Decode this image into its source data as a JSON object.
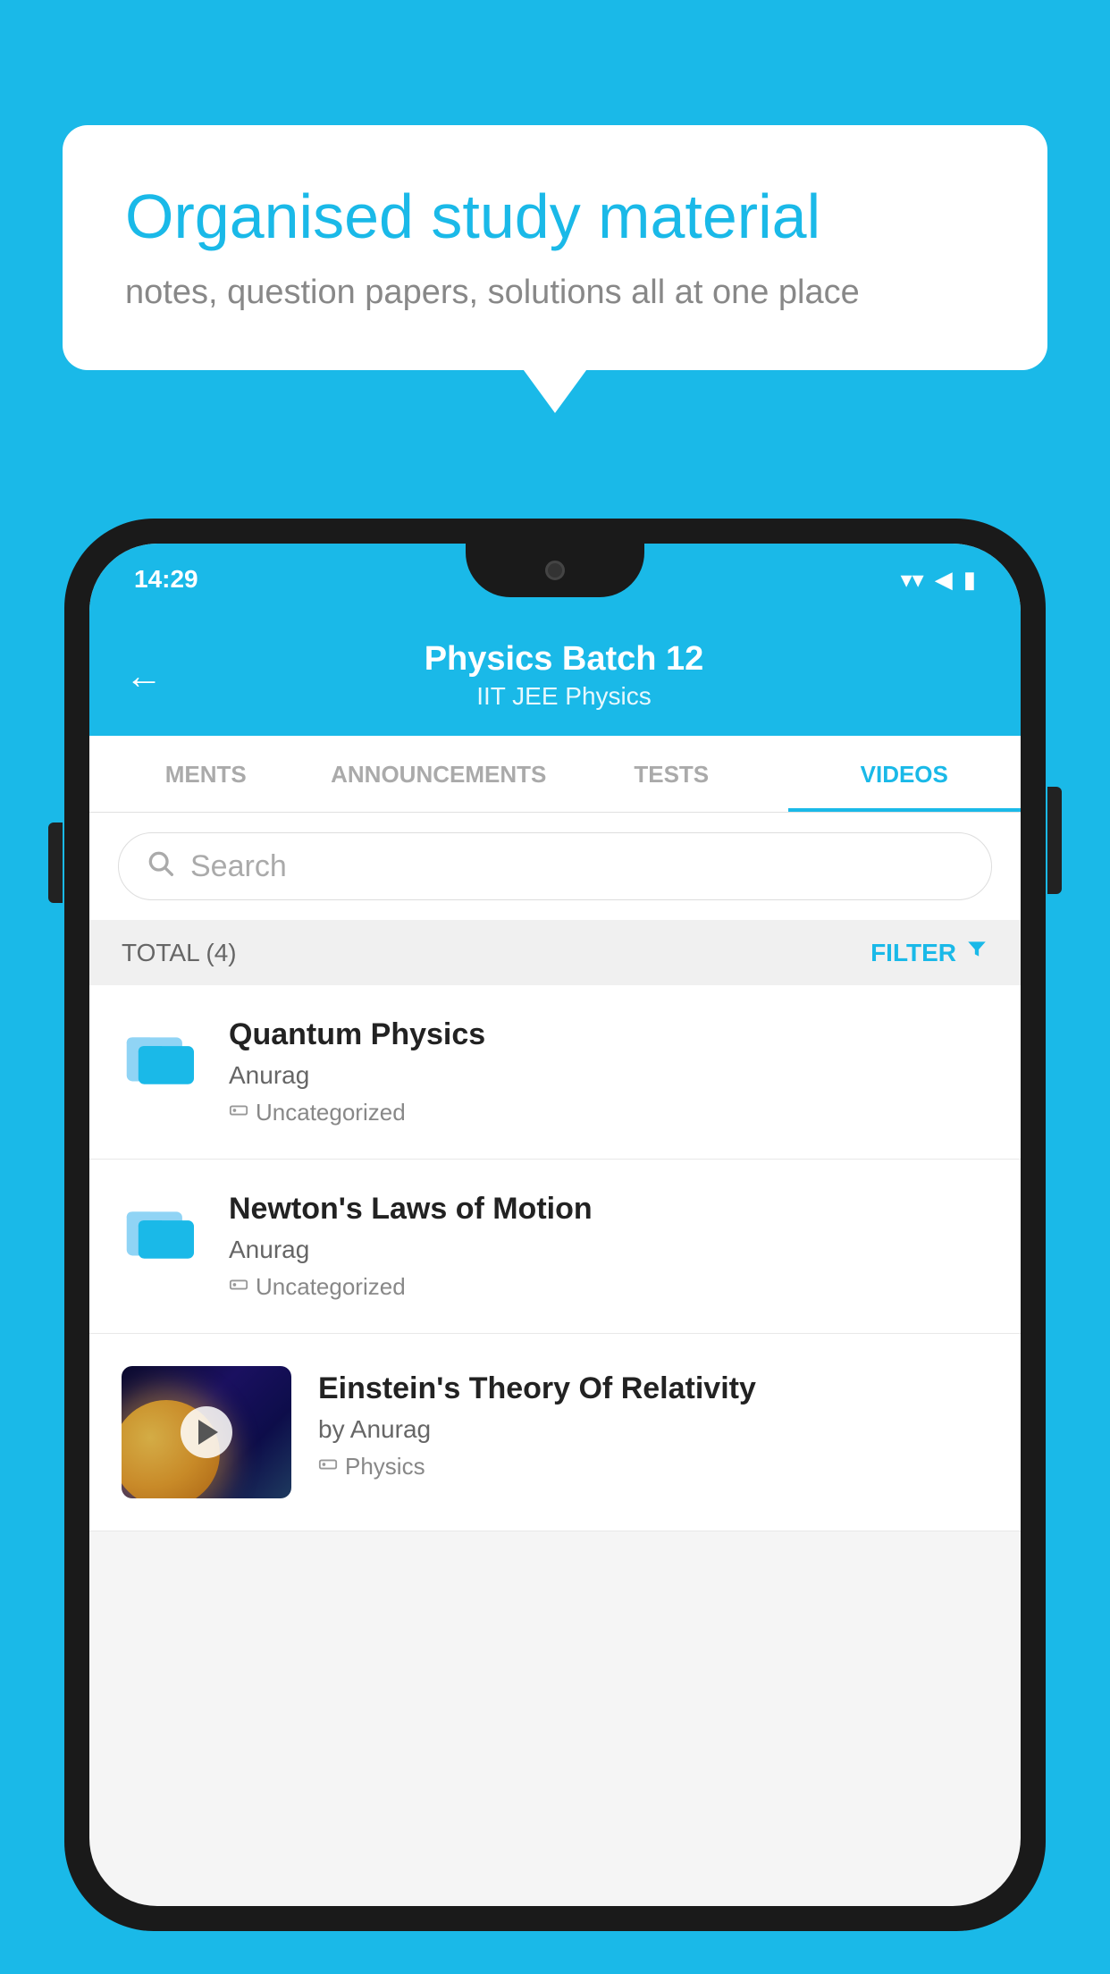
{
  "background_color": "#1ab9e8",
  "speech_bubble": {
    "title": "Organised study material",
    "subtitle": "notes, question papers, solutions all at one place"
  },
  "phone": {
    "status_bar": {
      "time": "14:29",
      "wifi": "▾",
      "signal": "◀",
      "battery": "▮"
    },
    "header": {
      "back_label": "←",
      "title": "Physics Batch 12",
      "subtitle": "IIT JEE   Physics"
    },
    "tabs": [
      {
        "label": "MENTS",
        "active": false
      },
      {
        "label": "ANNOUNCEMENTS",
        "active": false
      },
      {
        "label": "TESTS",
        "active": false
      },
      {
        "label": "VIDEOS",
        "active": true
      }
    ],
    "search": {
      "placeholder": "Search"
    },
    "filter_bar": {
      "total_label": "TOTAL (4)",
      "filter_label": "FILTER"
    },
    "videos": [
      {
        "title": "Quantum Physics",
        "author": "Anurag",
        "tag": "Uncategorized",
        "has_thumbnail": false
      },
      {
        "title": "Newton's Laws of Motion",
        "author": "Anurag",
        "tag": "Uncategorized",
        "has_thumbnail": false
      },
      {
        "title": "Einstein's Theory Of Relativity",
        "author": "by Anurag",
        "tag": "Physics",
        "has_thumbnail": true
      }
    ]
  }
}
